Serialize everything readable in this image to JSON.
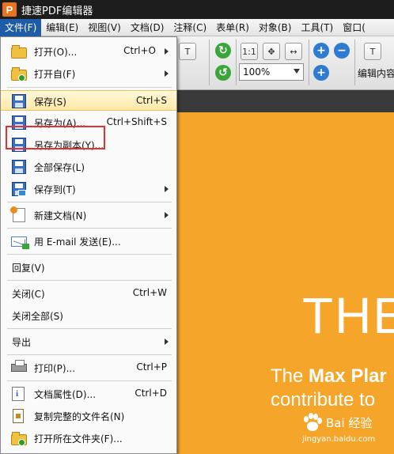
{
  "app": {
    "title": "捷速PDF编辑器",
    "logo_letter": "P"
  },
  "menubar": {
    "items": [
      "文件(F)",
      "编辑(E)",
      "视图(V)",
      "文档(D)",
      "注释(C)",
      "表单(R)",
      "对象(B)",
      "工具(T)",
      "窗口("
    ]
  },
  "toolbar": {
    "zoom_value": "100%",
    "edit_content_label": "编辑内容",
    "page_fit_label": "1:1"
  },
  "file_menu": {
    "items": [
      {
        "label": "打开(O)...",
        "shortcut": "Ctrl+O",
        "submenu": true,
        "icon": "open-folder-icon"
      },
      {
        "label": "打开自(F)",
        "shortcut": "",
        "submenu": true,
        "icon": "open-from-icon"
      },
      {
        "label": "保存(S)",
        "shortcut": "Ctrl+S",
        "submenu": false,
        "icon": "save-icon"
      },
      {
        "label": "另存为(A)...",
        "shortcut": "Ctrl+Shift+S",
        "submenu": false,
        "icon": "save-as-icon"
      },
      {
        "label": "另存为副本(Y)...",
        "shortcut": "",
        "submenu": false,
        "icon": "save-copy-icon"
      },
      {
        "label": "全部保存(L)",
        "shortcut": "",
        "submenu": false,
        "icon": "save-all-icon"
      },
      {
        "label": "保存到(T)",
        "shortcut": "",
        "submenu": true,
        "icon": "save-to-icon"
      },
      {
        "label": "新建文档(N)",
        "shortcut": "",
        "submenu": true,
        "icon": "new-document-icon"
      },
      {
        "label": "用 E-mail 发送(E)...",
        "shortcut": "",
        "submenu": false,
        "icon": "email-icon"
      },
      {
        "label": "回复(V)",
        "shortcut": "",
        "submenu": false,
        "icon": ""
      },
      {
        "label": "关闭(C)",
        "shortcut": "Ctrl+W",
        "submenu": false,
        "icon": ""
      },
      {
        "label": "关闭全部(S)",
        "shortcut": "",
        "submenu": false,
        "icon": ""
      },
      {
        "label": "导出",
        "shortcut": "",
        "submenu": true,
        "icon": ""
      },
      {
        "label": "打印(P)...",
        "shortcut": "Ctrl+P",
        "submenu": false,
        "icon": "printer-icon"
      },
      {
        "label": "文档属性(D)...",
        "shortcut": "Ctrl+D",
        "submenu": false,
        "icon": "document-properties-icon"
      },
      {
        "label": "复制完整的文件名(N)",
        "shortcut": "",
        "submenu": false,
        "icon": "copy-filename-icon"
      },
      {
        "label": "打开所在文件夹(F)...",
        "shortcut": "",
        "submenu": false,
        "icon": "open-containing-folder-icon"
      }
    ]
  },
  "document": {
    "heading": "THE",
    "line1_regular": "The ",
    "line1_bold": "Max Plar",
    "line2": "contribute to"
  },
  "watermark": {
    "main": "Bai 经验",
    "sub": "jingyan.baidu.com"
  },
  "colors": {
    "highlight": "#fde9a6",
    "red_box": "#e53030",
    "page_orange": "#f5a62a",
    "menu_active": "#1f5ca8"
  }
}
